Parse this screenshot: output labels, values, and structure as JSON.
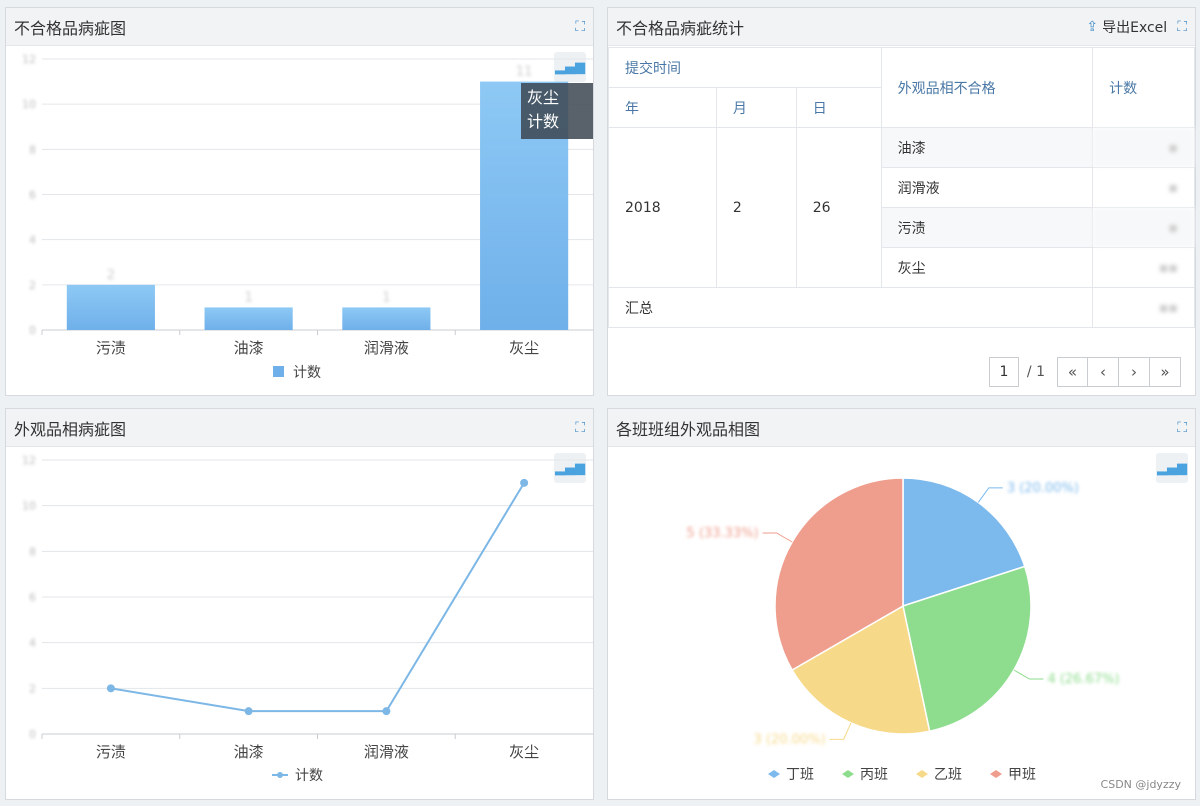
{
  "panel1": {
    "title": "不合格品病疵图",
    "categories": [
      "污渍",
      "油漆",
      "润滑液",
      "灰尘"
    ],
    "values": [
      2,
      1,
      1,
      11
    ],
    "legend": "计数",
    "tooltip": {
      "category": "灰尘",
      "label": "计数"
    }
  },
  "panel2": {
    "title": "不合格品病疵统计",
    "export_label": "导出Excel",
    "headers": {
      "submit_time": "提交时间",
      "year": "年",
      "month": "月",
      "day": "日",
      "defect": "外观品相不合格",
      "count": "计数"
    },
    "date": {
      "year": "2018",
      "month": "2",
      "day": "26"
    },
    "rows": [
      {
        "name": "油漆"
      },
      {
        "name": "润滑液"
      },
      {
        "name": "污渍"
      },
      {
        "name": "灰尘"
      }
    ],
    "total_label": "汇总",
    "pager": {
      "current": "1",
      "total": "/ 1"
    }
  },
  "panel3": {
    "title": "外观品相病疵图",
    "categories": [
      "污渍",
      "油漆",
      "润滑液",
      "灰尘"
    ],
    "values": [
      2,
      1,
      1,
      11
    ],
    "legend": "计数"
  },
  "panel4": {
    "title": "各班班组外观品相图",
    "legend": [
      "丁班",
      "丙班",
      "乙班",
      "甲班"
    ],
    "colors": [
      "#7cb9ec",
      "#8edc8e",
      "#f7d98a",
      "#ef9e8e"
    ]
  },
  "chart_data": [
    {
      "type": "bar",
      "categories": [
        "污渍",
        "油漆",
        "润滑液",
        "灰尘"
      ],
      "series": [
        {
          "name": "计数",
          "values": [
            2,
            1,
            1,
            11
          ]
        }
      ],
      "ylim": [
        0,
        12
      ]
    },
    {
      "type": "line",
      "categories": [
        "污渍",
        "油漆",
        "润滑液",
        "灰尘"
      ],
      "series": [
        {
          "name": "计数",
          "values": [
            2,
            1,
            1,
            11
          ]
        }
      ],
      "ylim": [
        0,
        12
      ]
    },
    {
      "type": "pie",
      "categories": [
        "丁班",
        "丙班",
        "乙班",
        "甲班"
      ],
      "values": [
        3,
        4,
        3,
        5
      ]
    }
  ],
  "watermark": "CSDN @jdyzzy"
}
